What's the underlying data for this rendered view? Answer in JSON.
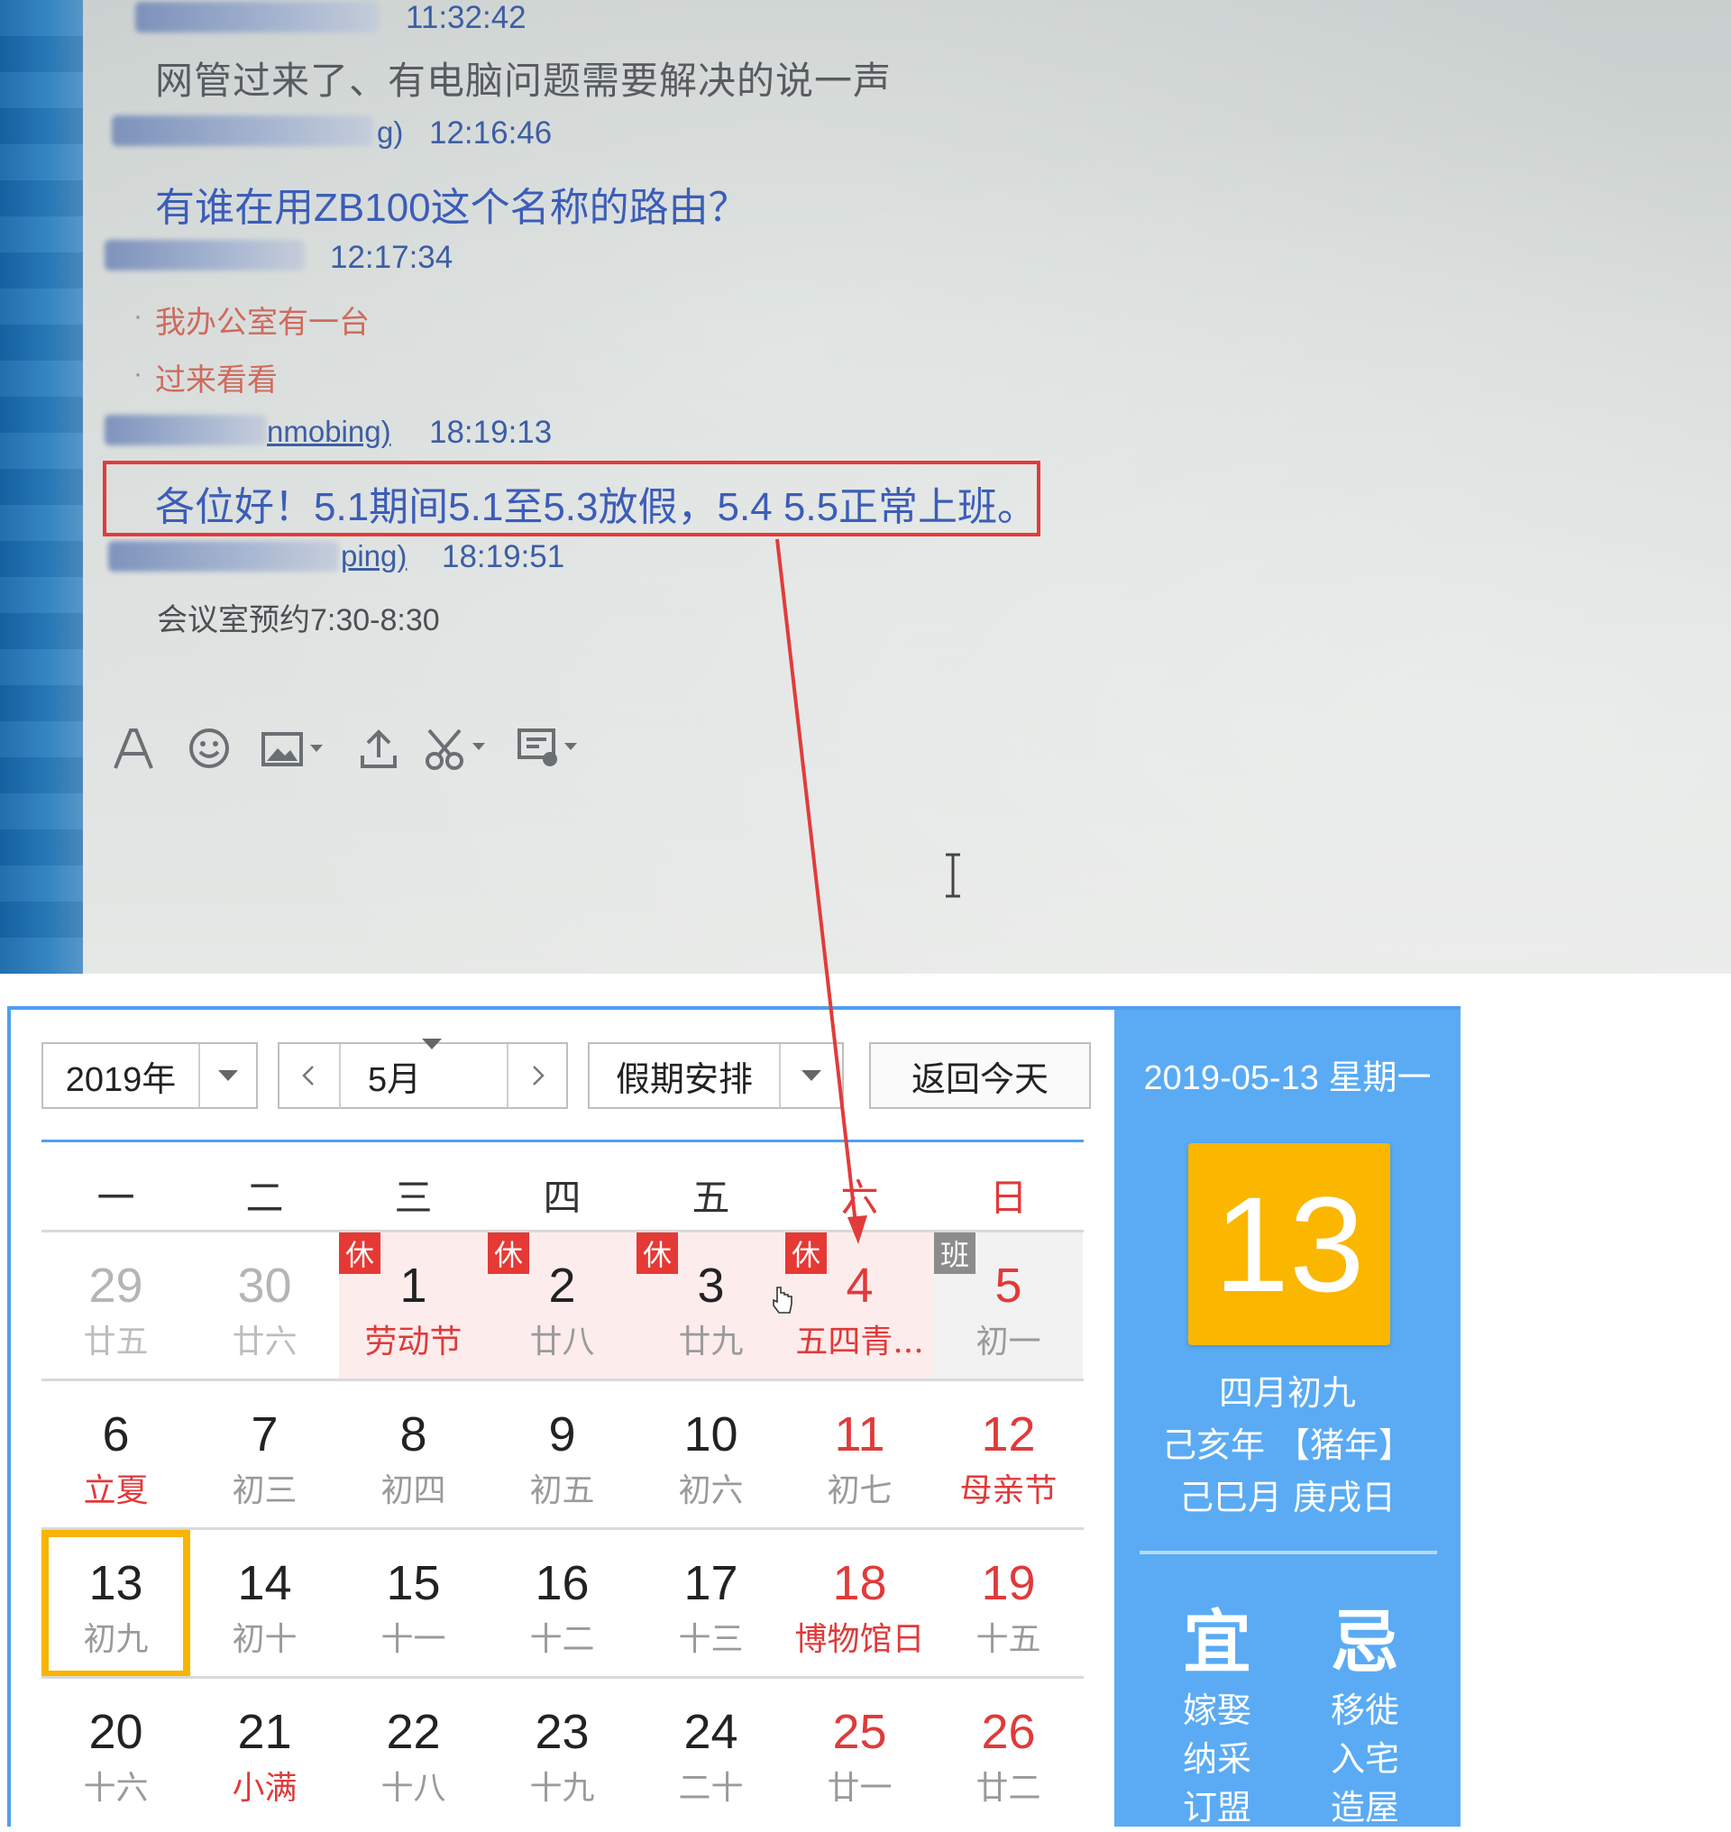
{
  "chat": {
    "messages": [
      {
        "name_suffix": "",
        "time": "11:32:42",
        "text": "网管过来了、有电脑问题需要解决的说一声",
        "style": "gray"
      },
      {
        "name_suffix": "g)",
        "time": "12:16:46",
        "text": "有谁在用ZB100这个名称的路由？",
        "style": "blue"
      },
      {
        "name_suffix": "",
        "time": "12:17:34",
        "lines": [
          "我办公室有一台",
          "过来看看"
        ],
        "style": "red"
      },
      {
        "name_suffix": "nmobing)",
        "time": "18:19:13",
        "text": "各位好！5.1期间5.1至5.3放假，5.4  5.5正常上班。",
        "style": "blue",
        "highlighted": true
      },
      {
        "name_suffix": "ping)",
        "time": "18:19:51",
        "text": "会议室预约7:30-8:30",
        "style": "small"
      }
    ],
    "toolbar_icons": [
      "font-icon",
      "emoji-icon",
      "image-icon",
      "upload-icon",
      "scissors-icon",
      "chat-history-icon"
    ],
    "highlight_color": "#e23b3b"
  },
  "calendar": {
    "year_label": "2019年",
    "month_label": "5月",
    "holiday_label": "假期安排",
    "today_button": "返回今天",
    "weekdays": [
      "一",
      "二",
      "三",
      "四",
      "五",
      "六",
      "日"
    ],
    "weeks": [
      [
        {
          "day": "29",
          "lunar": "廿五",
          "other": true
        },
        {
          "day": "30",
          "lunar": "廿六",
          "other": true
        },
        {
          "day": "1",
          "lunar": "劳动节",
          "tag": "休",
          "lunar_red": true
        },
        {
          "day": "2",
          "lunar": "廿八",
          "tag": "休"
        },
        {
          "day": "3",
          "lunar": "廿九",
          "tag": "休"
        },
        {
          "day": "4",
          "lunar": "五四青...",
          "tag": "休",
          "red": true,
          "lunar_red": true
        },
        {
          "day": "5",
          "lunar": "初一",
          "tag": "班",
          "red": true
        }
      ],
      [
        {
          "day": "6",
          "lunar": "立夏",
          "lunar_red": true
        },
        {
          "day": "7",
          "lunar": "初三"
        },
        {
          "day": "8",
          "lunar": "初四"
        },
        {
          "day": "9",
          "lunar": "初五"
        },
        {
          "day": "10",
          "lunar": "初六"
        },
        {
          "day": "11",
          "lunar": "初七",
          "red": true
        },
        {
          "day": "12",
          "lunar": "母亲节",
          "red": true,
          "lunar_red": true
        }
      ],
      [
        {
          "day": "13",
          "lunar": "初九",
          "today": true
        },
        {
          "day": "14",
          "lunar": "初十"
        },
        {
          "day": "15",
          "lunar": "十一"
        },
        {
          "day": "16",
          "lunar": "十二"
        },
        {
          "day": "17",
          "lunar": "十三"
        },
        {
          "day": "18",
          "lunar": "博物馆日",
          "red": true,
          "lunar_red": true
        },
        {
          "day": "19",
          "lunar": "十五",
          "red": true
        }
      ],
      [
        {
          "day": "20",
          "lunar": "十六"
        },
        {
          "day": "21",
          "lunar": "小满",
          "lunar_red": true
        },
        {
          "day": "22",
          "lunar": "十八"
        },
        {
          "day": "23",
          "lunar": "十九"
        },
        {
          "day": "24",
          "lunar": "二十"
        },
        {
          "day": "25",
          "lunar": "廿一",
          "red": true
        },
        {
          "day": "26",
          "lunar": "廿二",
          "red": true
        }
      ]
    ],
    "side": {
      "date": "2019-05-13 星期一",
      "big_day": "13",
      "lunar_date": "四月初九",
      "year_ganzhi": "己亥年 【猪年】",
      "month_day_ganzhi": "己巳月 庚戌日",
      "yi_title": "宜",
      "ji_title": "忌",
      "yi_items": [
        "嫁娶",
        "纳采",
        "订盟"
      ],
      "ji_items": [
        "移徙",
        "入宅",
        "造屋"
      ]
    },
    "colors": {
      "accent": "#4f9ff0",
      "side_bg": "#5aabf4",
      "today": "#f7b500",
      "big_day_bg": "#fbb600",
      "holiday_tag": "#e53935",
      "work_tag": "#8c8c8c",
      "weekend_text": "#e03a3a"
    }
  }
}
